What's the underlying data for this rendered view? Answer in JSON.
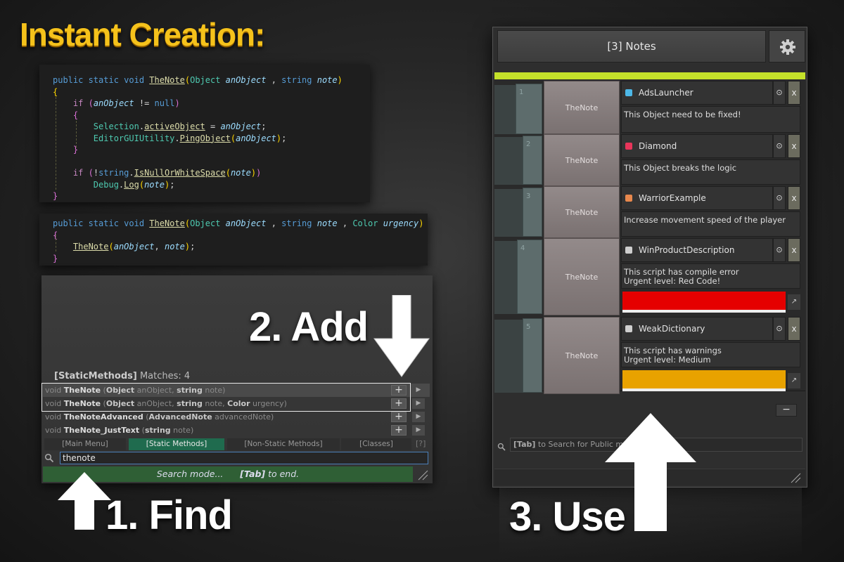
{
  "headline": "Instant Creation:",
  "steps": {
    "find": "1. Find",
    "add": "2. Add",
    "use": "3. Use"
  },
  "code": {
    "block1": [
      [
        [
          "kw",
          "public "
        ],
        [
          "kw",
          "static "
        ],
        [
          "kw",
          "void "
        ],
        [
          "fn u",
          "TheNote"
        ],
        [
          "br1",
          "("
        ],
        [
          "ty",
          "Object "
        ],
        [
          "pm",
          "anObject"
        ],
        [
          "",
          ""
        ],
        [
          "",
          " , "
        ],
        [
          "kw",
          "string "
        ],
        [
          "pm",
          "note"
        ],
        [
          "br1",
          ")"
        ]
      ],
      [
        [
          "br1",
          "{"
        ]
      ],
      [
        [
          "",
          "    "
        ],
        [
          "kw2",
          "if "
        ],
        [
          "br2",
          "("
        ],
        [
          "pm",
          "anObject"
        ],
        [
          "",
          " != "
        ],
        [
          "kw",
          "null"
        ],
        [
          "br2",
          ")"
        ]
      ],
      [
        [
          "",
          "    "
        ],
        [
          "br2",
          "{"
        ]
      ],
      [
        [
          "",
          "        "
        ],
        [
          "ty",
          "Selection"
        ],
        [
          "",
          "."
        ],
        [
          "fn u",
          "activeObject"
        ],
        [
          "",
          " = "
        ],
        [
          "pm",
          "anObject"
        ],
        [
          "",
          ";"
        ]
      ],
      [
        [
          "",
          "        "
        ],
        [
          "ty",
          "EditorGUIUtility"
        ],
        [
          "",
          "."
        ],
        [
          "fn u",
          "PingObject"
        ],
        [
          "br1",
          "("
        ],
        [
          "pm",
          "anObject"
        ],
        [
          "br1",
          ")"
        ],
        [
          "",
          ";"
        ]
      ],
      [
        [
          "",
          "    "
        ],
        [
          "br2",
          "}"
        ]
      ],
      [
        [
          "",
          ""
        ]
      ],
      [
        [
          "",
          "    "
        ],
        [
          "kw2",
          "if "
        ],
        [
          "br2",
          "("
        ],
        [
          "",
          "!"
        ],
        [
          "kw",
          "string"
        ],
        [
          "",
          "."
        ],
        [
          "fn u",
          "IsNullOrWhiteSpace"
        ],
        [
          "br1",
          "("
        ],
        [
          "pm",
          "note"
        ],
        [
          "br1",
          ")"
        ],
        [
          "br2",
          ")"
        ]
      ],
      [
        [
          "",
          "        "
        ],
        [
          "ty",
          "Debug"
        ],
        [
          "",
          "."
        ],
        [
          "fn u",
          "Log"
        ],
        [
          "br1",
          "("
        ],
        [
          "pm",
          "note"
        ],
        [
          "br1",
          ")"
        ],
        [
          "",
          ";"
        ]
      ],
      [
        [
          "br2",
          "}"
        ]
      ]
    ],
    "block2": [
      [
        [
          "kw",
          "public "
        ],
        [
          "kw",
          "static "
        ],
        [
          "kw",
          "void "
        ],
        [
          "fn u",
          "TheNote"
        ],
        [
          "br1",
          "("
        ],
        [
          "ty",
          "Object "
        ],
        [
          "pm",
          "anObject"
        ],
        [
          "",
          " , "
        ],
        [
          "kw",
          "string "
        ],
        [
          "pm",
          "note"
        ],
        [
          "",
          " , "
        ],
        [
          "ty",
          "Color "
        ],
        [
          "pm",
          "urgency"
        ],
        [
          "br1",
          ")"
        ]
      ],
      [
        [
          "br2",
          "{"
        ]
      ],
      [
        [
          "",
          "    "
        ],
        [
          "fn u",
          "TheNote"
        ],
        [
          "br1",
          "("
        ],
        [
          "pm",
          "anObject"
        ],
        [
          "",
          ", "
        ],
        [
          "pm",
          "note"
        ],
        [
          "br1",
          ")"
        ],
        [
          "",
          ";"
        ]
      ],
      [
        [
          "br2",
          "}"
        ]
      ]
    ]
  },
  "search_window": {
    "header_label": "[StaticMethods]",
    "matches_text": "Matches: 4",
    "results": [
      {
        "ret": "void ",
        "name": "TheNote",
        "params": [
          [
            "dim",
            " ("
          ],
          [
            "bt",
            "Object"
          ],
          [
            "dim",
            " anObject, "
          ],
          [
            "bt",
            "string"
          ],
          [
            "dim",
            " note)"
          ]
        ],
        "highlight": true
      },
      {
        "ret": "void ",
        "name": "TheNote",
        "params": [
          [
            "dim",
            " ("
          ],
          [
            "bt",
            "Object"
          ],
          [
            "dim",
            " anObject, "
          ],
          [
            "bt",
            "string"
          ],
          [
            "dim",
            " note, "
          ],
          [
            "bt",
            "Color"
          ],
          [
            "dim",
            " urgency)"
          ]
        ],
        "highlight": false
      },
      {
        "ret": "void ",
        "name": "TheNoteAdvanced",
        "params": [
          [
            "dim",
            " ("
          ],
          [
            "bt",
            "AdvancedNote"
          ],
          [
            "dim",
            " advancedNote)"
          ]
        ],
        "highlight": false
      },
      {
        "ret": "void ",
        "name": "TheNote_JustText",
        "params": [
          [
            "dim",
            " ("
          ],
          [
            "bt",
            "string"
          ],
          [
            "dim",
            " note)"
          ]
        ],
        "highlight": false
      }
    ],
    "add_label": "+",
    "tabs": [
      "[Main Menu]",
      "[Static Methods]",
      "[Non-Static Methods]",
      "[Classes]"
    ],
    "active_tab": 1,
    "help": "[?]",
    "query": "thenote",
    "status_prefix": "Search mode...",
    "status_key": "[Tab]",
    "status_suffix": "to end."
  },
  "notes_window": {
    "title": "[3] Notes",
    "notes": [
      {
        "index": "1",
        "button": "TheNote",
        "title": "AdsLauncher",
        "icon_color": "#4db8e8",
        "text": "This Object need to be fixed!",
        "color": null
      },
      {
        "index": "2",
        "button": "TheNote",
        "title": "Diamond",
        "icon_color": "#e8355a",
        "text": "This Object breaks the logic",
        "color": null
      },
      {
        "index": "3",
        "button": "TheNote",
        "title": "WarriorExample",
        "icon_color": "#e8884d",
        "text": "Increase movement speed of the player",
        "color": null
      },
      {
        "index": "4",
        "button": "TheNote",
        "title": "WinProductDescription",
        "icon_color": "#cfcfcf",
        "text": "This script has compile error\nUrgent level: Red Code!",
        "color": "#e50000"
      },
      {
        "index": "5",
        "button": "TheNote",
        "title": "WeakDictionary",
        "icon_color": "#cfcfcf",
        "text": "This script has warnings\nUrgent level: Medium",
        "color": "#e8a200"
      }
    ],
    "close_label": "x",
    "minus_label": "−",
    "search_key": "[Tab]",
    "search_text": "to Search for Public m"
  }
}
